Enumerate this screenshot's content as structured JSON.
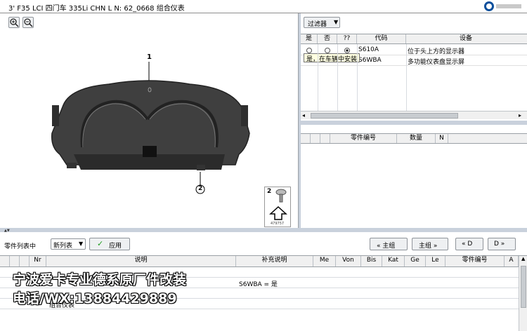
{
  "window": {
    "title": "3' F35 LCI 四门车 335Li CHN  L N: 62_0668 组合仪表"
  },
  "toolbar": {
    "zoom_in": "zoom-in",
    "zoom_out": "zoom-out"
  },
  "diagram": {
    "callout_1": "1",
    "callout_2": "2",
    "side_num": "2",
    "image_id": "479757"
  },
  "filter": {
    "button_label": "过滤器",
    "columns": [
      "是",
      "否",
      "??",
      "代码",
      "设备"
    ],
    "rows": [
      {
        "code": "S610A",
        "desc": "位于头上方的显示器"
      },
      {
        "code": "S6WBA",
        "desc": "多功能仪表盘显示屏"
      }
    ],
    "tooltip": "是，在车辆中安装"
  },
  "parts_mini": {
    "columns": [
      "零件编号",
      "数量",
      "N"
    ]
  },
  "partslist": {
    "label": "零件列表中",
    "select_value": "新列表",
    "apply_label": "应用",
    "nav": [
      "« 主组",
      "主组 »",
      "« D",
      "D »"
    ],
    "columns": [
      "Nr",
      "说明",
      "补充说明",
      "Me",
      "Von",
      "Bis",
      "Kat",
      "Ge",
      "Le",
      "零件编号",
      "A"
    ],
    "rows": [
      {
        "nr": "",
        "desc": "",
        "extra": "S6WBA = 是"
      },
      {
        "nr": "01",
        "desc": "组合仪表",
        "extra": ""
      }
    ]
  },
  "watermark": {
    "line1": "宁波爱卡专业德系原厂件改装",
    "line2": "电话/WX:13884429889"
  }
}
